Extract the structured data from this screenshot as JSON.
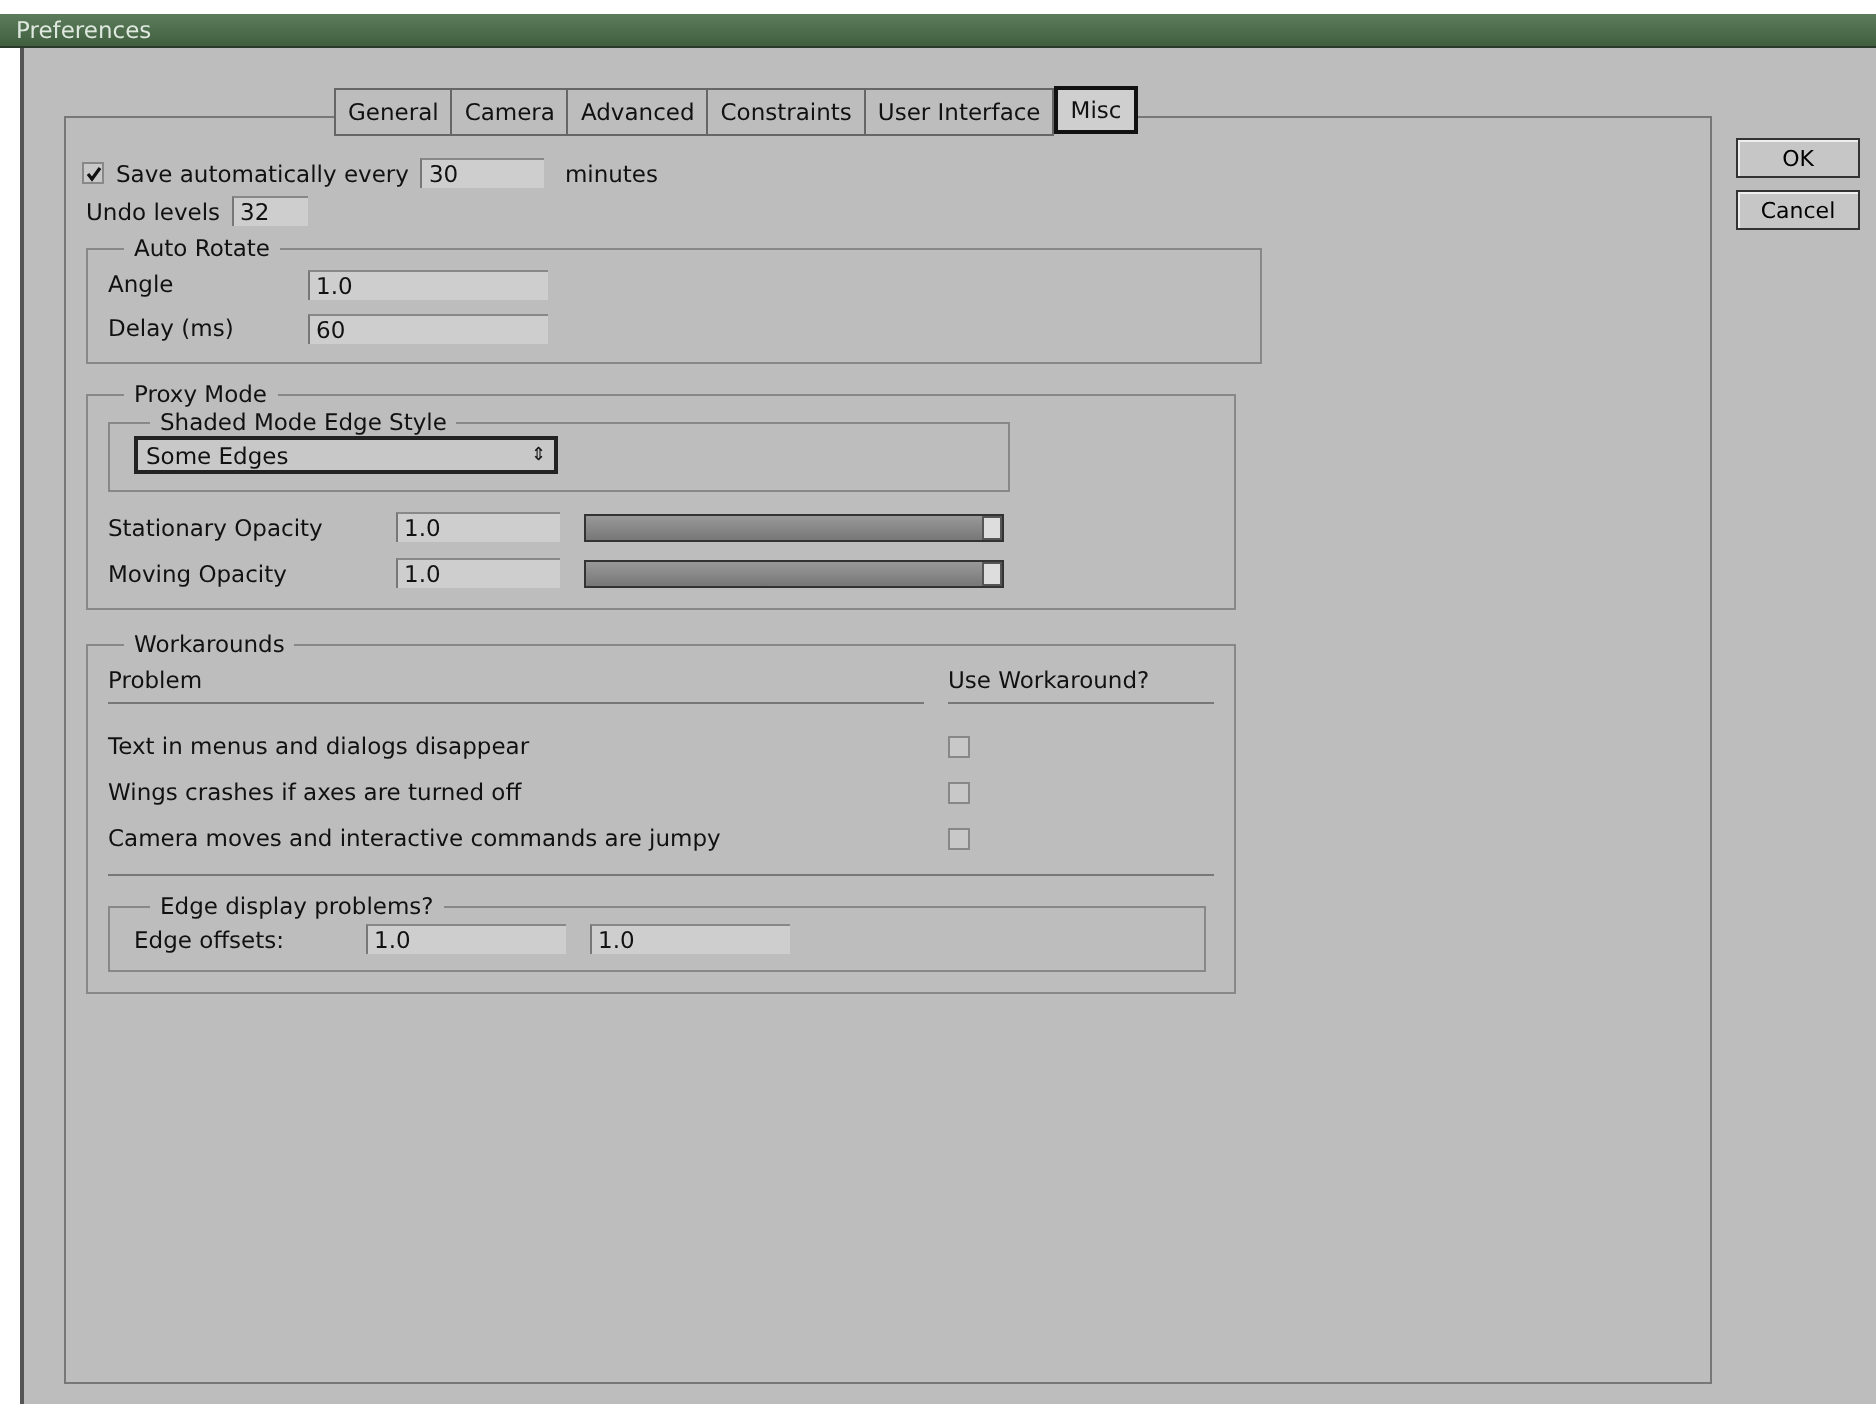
{
  "window": {
    "title": "Preferences"
  },
  "tabs": [
    {
      "label": "General",
      "selected": false
    },
    {
      "label": "Camera",
      "selected": false
    },
    {
      "label": "Advanced",
      "selected": false
    },
    {
      "label": "Constraints",
      "selected": false
    },
    {
      "label": "User Interface",
      "selected": false
    },
    {
      "label": "Misc",
      "selected": true
    }
  ],
  "buttons": [
    "OK",
    "Cancel"
  ],
  "autosave": {
    "checked": true,
    "label": "Save automatically every",
    "value": "30",
    "unit": "minutes"
  },
  "undo": {
    "label": "Undo levels",
    "value": "32"
  },
  "auto_rotate": {
    "title": "Auto Rotate",
    "fields": [
      {
        "label": "Angle",
        "value": "1.0"
      },
      {
        "label": "Delay (ms)",
        "value": "60"
      }
    ]
  },
  "proxy_mode": {
    "title": "Proxy Mode",
    "edge_style": {
      "title": "Shaded Mode Edge Style",
      "value": "Some Edges",
      "arrow": "⇕"
    },
    "opacities": [
      {
        "label": "Stationary Opacity",
        "value": "1.0",
        "level": 1.0
      },
      {
        "label": "Moving Opacity",
        "value": "1.0",
        "level": 1.0
      }
    ]
  },
  "workarounds": {
    "title": "Workarounds",
    "columns": [
      "Problem",
      "Use Workaround?"
    ],
    "rows": [
      {
        "problem": "Text in menus and dialogs disappear",
        "checked": false
      },
      {
        "problem": "Wings crashes if axes are turned off",
        "checked": false
      },
      {
        "problem": "Camera moves and interactive commands are jumpy",
        "checked": false
      }
    ],
    "edge": {
      "title": "Edge display problems?",
      "label": "Edge offsets:",
      "values": [
        "1.0",
        "1.0"
      ]
    }
  }
}
